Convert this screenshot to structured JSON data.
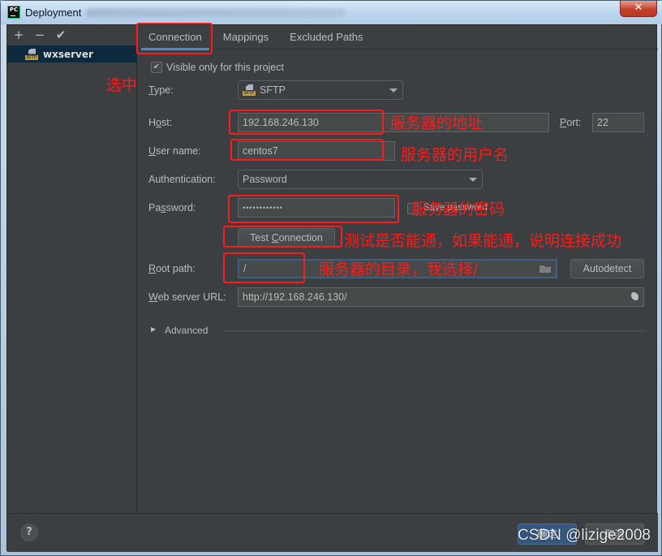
{
  "window": {
    "app_icon": "pycharm-icon",
    "app_icon_text": "PC",
    "title": "Deployment",
    "close_glyph": "✕"
  },
  "sidebar": {
    "toolbar": {
      "add": "+",
      "remove": "−",
      "apply": "✔"
    },
    "servers": [
      {
        "name": "wxserver",
        "type_icon": "sftp-icon",
        "icon_label": "SFTP",
        "selected": true
      }
    ]
  },
  "tabs": [
    {
      "label": "Connection",
      "active": true
    },
    {
      "label": "Mappings",
      "active": false
    },
    {
      "label": "Excluded Paths",
      "active": false
    }
  ],
  "form": {
    "visible_only": {
      "label": "Visible only for this project",
      "checked": true,
      "check_glyph": "✔"
    },
    "type": {
      "label_mnemonic": "T",
      "label_rest": "ype:",
      "value": "SFTP",
      "icon_label": "SFTP"
    },
    "host": {
      "label_pre": "H",
      "label_mnemonic": "o",
      "label_post": "st:",
      "value": "192.168.246.130"
    },
    "port": {
      "label_mnemonic": "P",
      "label_rest": "ort:",
      "value": "22"
    },
    "user_name": {
      "label_mnemonic": "U",
      "label_rest": "ser name:",
      "value": "centos7"
    },
    "authentication": {
      "label": "Authentication:",
      "value": "Password"
    },
    "password": {
      "label_pre": "Pa",
      "label_mnemonic": "s",
      "label_post": "sword:",
      "value": "••••••••••••"
    },
    "save_password": {
      "label": "Save password",
      "checked": false
    },
    "test_connection": {
      "label_pre": "Test ",
      "label_mnemonic": "C",
      "label_post": "onnection"
    },
    "root_path": {
      "label_mnemonic": "R",
      "label_rest": "oot path:",
      "value": "/"
    },
    "autodetect": {
      "label": "Autodetect"
    },
    "web_server_url": {
      "label_mnemonic": "W",
      "label_rest": "eb server URL:",
      "value": "http://192.168.246.130/"
    },
    "advanced": {
      "label": "Advanced",
      "expand_glyph": "▶"
    }
  },
  "footer": {
    "help": "?",
    "ok": "确定",
    "cancel": "取消"
  },
  "annotations": {
    "select": "选中",
    "host": "服务器的地址",
    "user": "服务器的用户名",
    "password": "服务器的密码",
    "test": "测试是否能通，如果能通，说明连接成功",
    "root": "服务器的目录，我选择/"
  },
  "watermark": "CSDN @lizige2008"
}
